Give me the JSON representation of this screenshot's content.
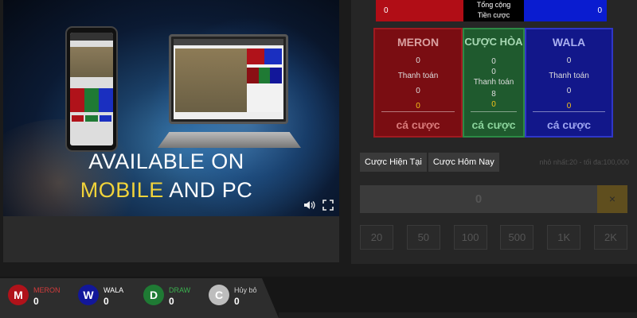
{
  "video": {
    "headline_line1": "AVAILABLE ON",
    "headline_line2_a": "MOBILE",
    "headline_line2_b": " AND PC",
    "volume_icon": "speaker-icon",
    "fullscreen_icon": "fullscreen-icon"
  },
  "totals": {
    "meron_total": "0",
    "label_line1": "Tổng cộng",
    "label_line2": "Tiền cược",
    "wala_total": "0"
  },
  "bet_boxes": [
    {
      "title": "MERON",
      "v1": "0",
      "label": "Thanh toán",
      "v3": "0",
      "v4": "0",
      "bet": "cá cược",
      "color": "#7a0d12"
    },
    {
      "title": "CƯỢC HÒA",
      "v1": "0",
      "v2": "0",
      "label": "Thanh toán",
      "v3": "8",
      "v4": "0",
      "bet": "cá cược",
      "color": "#1f5a2e"
    },
    {
      "title": "WALA",
      "v1": "0",
      "label": "Thanh toán",
      "v3": "0",
      "v4": "0",
      "bet": "cá cược",
      "color": "#12178a"
    }
  ],
  "tabs": [
    "Cược Hiện Tại",
    "Cược Hôm Nay"
  ],
  "limit_text": "nhỏ nhất:20 - tối đa:100,000",
  "amount_value": "0",
  "clear_symbol": "×",
  "chips": [
    "20",
    "50",
    "100",
    "500",
    "1K",
    "2K"
  ],
  "results": [
    {
      "letter": "M",
      "name": "MERON",
      "count": "0",
      "color": "#b0121a",
      "name_color": "#d23b3b"
    },
    {
      "letter": "W",
      "name": "WALA",
      "count": "0",
      "color": "#12179a",
      "name_color": "#ffffff"
    },
    {
      "letter": "D",
      "name": "DRAW",
      "count": "0",
      "color": "#1f7a34",
      "name_color": "#3bb04f"
    },
    {
      "letter": "C",
      "name": "Hủy bỏ",
      "count": "0",
      "color": "#bdbdbd",
      "name_color": "#cfcfcf"
    }
  ]
}
